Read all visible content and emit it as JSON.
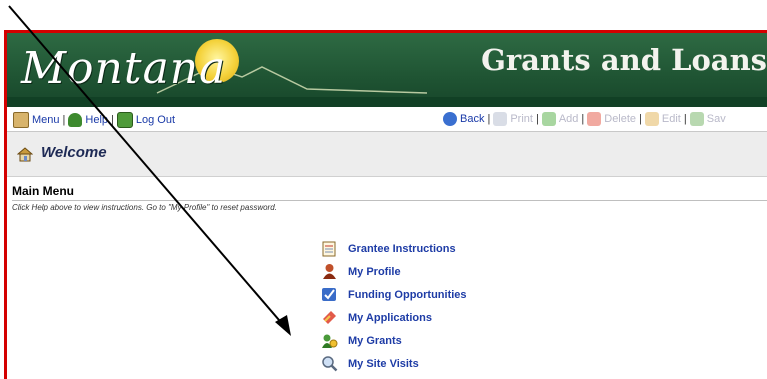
{
  "banner": {
    "logo_text": "Montana",
    "title": "Grants and Loans"
  },
  "toolbar": {
    "left": [
      {
        "label": "Menu",
        "icon": "home-icon"
      },
      {
        "label": "Help",
        "icon": "help-person-icon"
      },
      {
        "label": "Log Out",
        "icon": "logout-icon"
      }
    ],
    "right": [
      {
        "label": "Back",
        "icon": "back-arrow-icon",
        "enabled": true
      },
      {
        "label": "Print",
        "icon": "print-icon",
        "enabled": false
      },
      {
        "label": "Add",
        "icon": "add-icon",
        "enabled": false
      },
      {
        "label": "Delete",
        "icon": "delete-icon",
        "enabled": false
      },
      {
        "label": "Edit",
        "icon": "edit-icon",
        "enabled": false
      },
      {
        "label": "Sav",
        "icon": "save-icon",
        "enabled": false
      }
    ],
    "separator": "|"
  },
  "welcome": {
    "title": "Welcome"
  },
  "main": {
    "heading": "Main Menu",
    "help_text": "Click Help above to view instructions. Go to \"My Profile\" to reset password.",
    "items": [
      {
        "label": "Grantee Instructions",
        "icon": "notepad-icon"
      },
      {
        "label": "My Profile",
        "icon": "profile-person-icon"
      },
      {
        "label": "Funding Opportunities",
        "icon": "opportunities-icon"
      },
      {
        "label": "My Applications",
        "icon": "applications-icon"
      },
      {
        "label": "My Grants",
        "icon": "grants-icon"
      },
      {
        "label": "My Site Visits",
        "icon": "magnifier-icon"
      }
    ]
  },
  "colors": {
    "frame": "#d40000",
    "banner_green": "#1f5433",
    "link_blue": "#1e3ca6",
    "sun": "#f4d23b"
  }
}
